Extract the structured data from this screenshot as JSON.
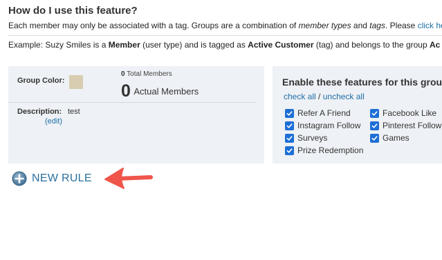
{
  "help": {
    "title": "How do I use this feature?",
    "text_part1": "Each member may only be associated with a tag. Groups are a combination of ",
    "text_em1": "member types",
    "text_part2": " and ",
    "text_em2": "tags",
    "text_part3": ". Please ",
    "click_here": "click here",
    "example_prefix": "Example: Suzy Smiles is a ",
    "example_member": "Member",
    "example_mid1": " (user type) and is tagged as ",
    "example_tag": "Active Customer",
    "example_mid2": " (tag) and belongs to the group ",
    "example_group": "Ac"
  },
  "group": {
    "color_label": "Group Color:",
    "color_value": "#d8cdb0",
    "total_members_count": "0",
    "total_members_label": "Total Members",
    "actual_members_count": "0",
    "actual_members_label": "Actual Members",
    "description_label": "Description:",
    "description_value": "test",
    "edit_link": "(edit)"
  },
  "features": {
    "title": "Enable these features for this grou",
    "check_all": "check all",
    "separator": "/",
    "uncheck_all": "uncheck all",
    "items": [
      {
        "label": "Refer A Friend",
        "checked": true
      },
      {
        "label": "Facebook Like",
        "checked": true
      },
      {
        "label": "Instagram Follow",
        "checked": true
      },
      {
        "label": "Pinterest Follow",
        "checked": true
      },
      {
        "label": "Surveys",
        "checked": true
      },
      {
        "label": "Games",
        "checked": true
      },
      {
        "label": "Prize Redemption",
        "checked": true
      }
    ]
  },
  "actions": {
    "new_rule_label": "NEW RULE",
    "plus_icon": "plus-circle-icon",
    "arrow_icon": "red-arrow-icon",
    "arrow_color": "#f0554a"
  }
}
